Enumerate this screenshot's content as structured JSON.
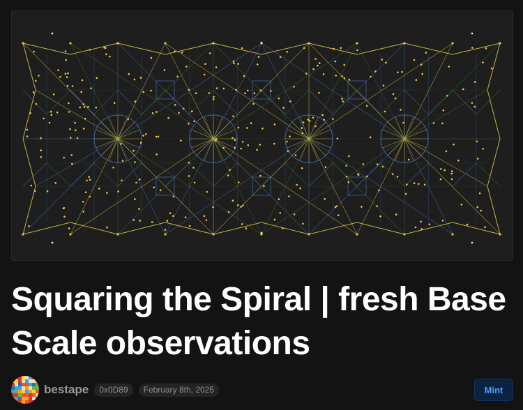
{
  "artwork": {
    "name": "generative-geometric-artwork",
    "colors": {
      "background": "#1e1e1e",
      "outer_lines": "#d6c24a",
      "inner_lines_blue": "#4a6fb3",
      "inner_lines_green": "#3a6b32",
      "dots": "#f2c64a",
      "accent_dots": "#e9e9e9"
    }
  },
  "post": {
    "title": "Squaring the Spiral | fresh Base Scale observations",
    "author": "bestape",
    "address": "0x0D89",
    "date": "February 8th, 2025"
  },
  "actions": {
    "mint_label": "Mint"
  },
  "theme": {
    "page_background": "#131313",
    "title_color": "#ffffff",
    "muted_text": "#9a9a9a",
    "accent": "#4f9bff"
  }
}
